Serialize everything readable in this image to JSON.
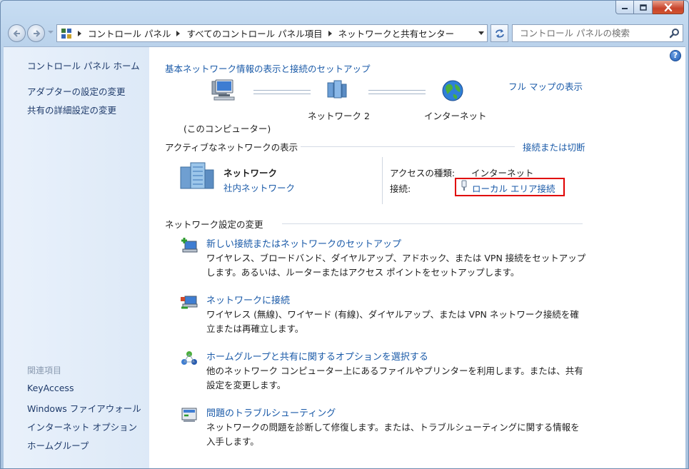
{
  "window": {
    "controls": {
      "minimize_icon": "minimize-icon",
      "maximize_icon": "maximize-icon",
      "close_icon": "close-icon"
    }
  },
  "navigation": {
    "breadcrumb": [
      "コントロール パネル",
      "すべてのコントロール パネル項目",
      "ネットワークと共有センター"
    ],
    "search_placeholder": "コントロール パネルの検索"
  },
  "sidebar": {
    "home": "コントロール パネル ホーム",
    "tasks": [
      "アダプターの設定の変更",
      "共有の詳細設定の変更"
    ],
    "related_heading": "関連項目",
    "related": [
      "KeyAccess",
      "Windows ファイアウォール",
      "インターネット オプション",
      "ホームグループ"
    ]
  },
  "main": {
    "title": "基本ネットワーク情報の表示と接続のセットアップ",
    "full_map": "フル マップの表示",
    "map": {
      "computer": "(このコンピューター)",
      "network": "ネットワーク  2",
      "internet": "インターネット"
    },
    "active": {
      "heading": "アクティブなネットワークの表示",
      "connect_link": "接続または切断",
      "network_name": "ネットワーク",
      "network_type": "社内ネットワーク",
      "access_label": "アクセスの種類:",
      "access_value": "インターネット",
      "conn_label": "接続:",
      "conn_value": "ローカル エリア接続"
    },
    "change": {
      "heading": "ネットワーク設定の変更",
      "tasks": [
        {
          "title": "新しい接続またはネットワークのセットアップ",
          "desc": "ワイヤレス、ブロードバンド、ダイヤルアップ、アドホック、または VPN 接続をセットアップします。あるいは、ルーターまたはアクセス ポイントをセットアップします。"
        },
        {
          "title": "ネットワークに接続",
          "desc": "ワイヤレス (無線)、ワイヤード (有線)、ダイヤルアップ、または VPN ネットワーク接続を確立または再確立します。"
        },
        {
          "title": "ホームグループと共有に関するオプションを選択する",
          "desc": "他のネットワーク コンピューター上にあるファイルやプリンターを利用します。または、共有設定を変更します。"
        },
        {
          "title": "問題のトラブルシューティング",
          "desc": "ネットワークの問題を診断して修復します。または、トラブルシューティングに関する情報を入手します。"
        }
      ]
    }
  }
}
